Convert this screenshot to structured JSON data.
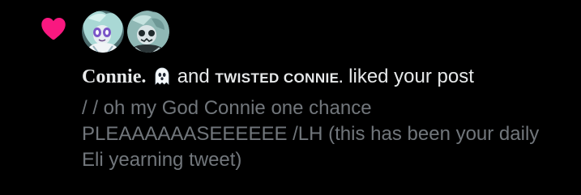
{
  "notification": {
    "type": "like",
    "accent_color": "#f91880",
    "background_color": "#000000",
    "icons": [
      "heart-icon",
      "ghost-emoji-icon"
    ],
    "avatars": [
      {
        "name": "avatar-connie"
      },
      {
        "name": "avatar-twisted-connie"
      }
    ],
    "user1_name": "Connie.",
    "conjunction": "and",
    "user2_name": "TWISTED CONNIE.",
    "action_text": "liked your post",
    "post_text": "/ / oh my God Connie one chance PLEAAAAAASEEEEEE /LH (this has been your daily Eli yearning tweet)"
  }
}
